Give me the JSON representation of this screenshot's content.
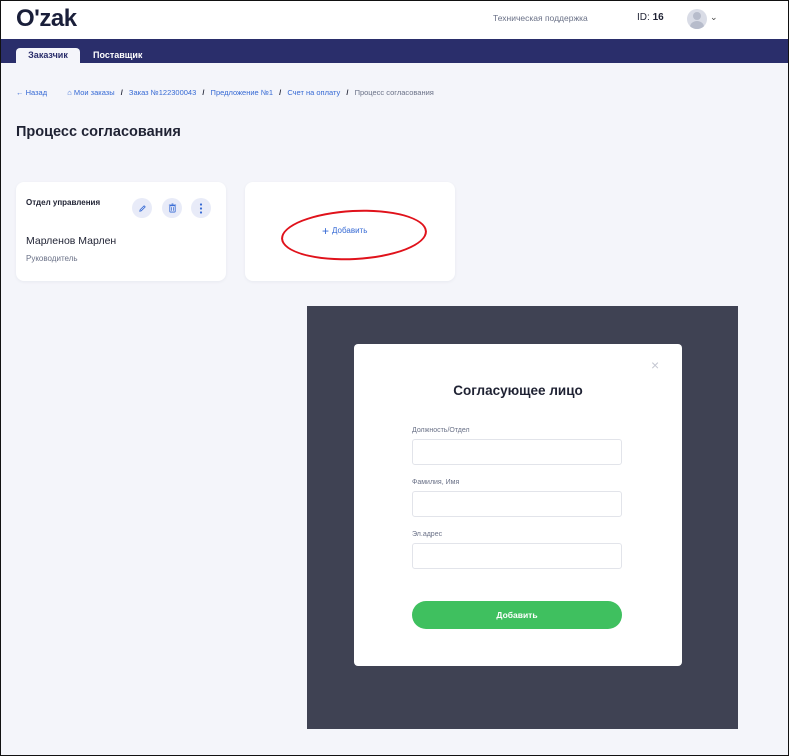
{
  "app": {
    "logo": "O'zak",
    "support_link": "Техническая поддержка",
    "id_label": "ID:",
    "id_value": "16"
  },
  "tabs": [
    {
      "label": "Заказчик",
      "active": true
    },
    {
      "label": "Поставщик",
      "active": false
    }
  ],
  "breadcrumb": {
    "back": "← Назад",
    "items": [
      "Мои заказы",
      "Заказ №122300043",
      "Предложение №1",
      "Счет на оплату"
    ],
    "current": "Процесс согласования",
    "separator": "/"
  },
  "page": {
    "title": "Процесс согласования"
  },
  "approver_card": {
    "department": "Отдел управления",
    "name": "Марленов Марлен",
    "role": "Руководитель"
  },
  "add_card": {
    "label": "Добавить"
  },
  "modal": {
    "title": "Согласующее лицо",
    "fields": [
      {
        "label": "Должность/Отдел",
        "value": ""
      },
      {
        "label": "Фамилия, Имя",
        "value": ""
      },
      {
        "label": "Эл.адрес",
        "value": ""
      }
    ],
    "submit_label": "Добавить",
    "close_symbol": "×"
  },
  "colors": {
    "nav": "#2a2e6b",
    "link": "#3569d4",
    "primary_button": "#3fc05f",
    "overlay": "#3f4253",
    "annotation": "#e0121b"
  },
  "icons": [
    "home-icon",
    "edit-icon",
    "trash-icon",
    "more-vertical-icon",
    "plus-icon",
    "close-icon",
    "avatar-icon",
    "chevron-down-icon"
  ]
}
